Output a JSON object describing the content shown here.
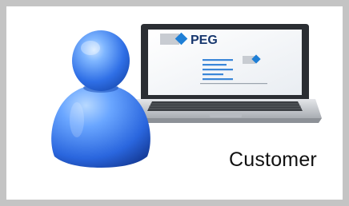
{
  "caption": "Customer",
  "logo_text": "PEG",
  "colors": {
    "frame_border": "#c4c4c4",
    "person_blue": "#2f6fe6",
    "person_light": "#8fc0ff",
    "brand_blue": "#1f7fd6",
    "laptop_silver": "#c9ccd0",
    "screen_bezel": "#2b2e33"
  },
  "icons": [
    "person-icon",
    "laptop-icon",
    "diamond-logo-icon"
  ]
}
